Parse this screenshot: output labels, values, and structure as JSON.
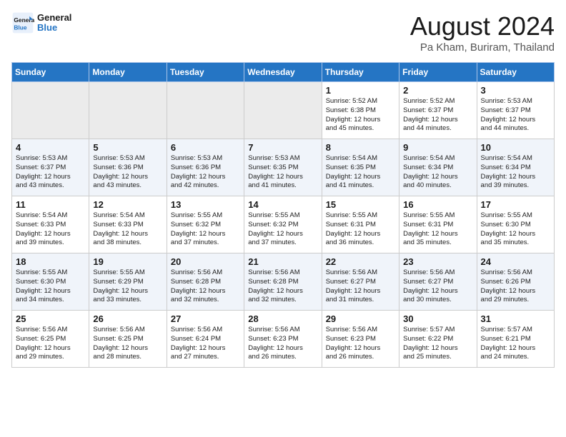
{
  "header": {
    "logo_line1": "General",
    "logo_line2": "Blue",
    "month": "August 2024",
    "location": "Pa Kham, Buriram, Thailand"
  },
  "days_of_week": [
    "Sunday",
    "Monday",
    "Tuesday",
    "Wednesday",
    "Thursday",
    "Friday",
    "Saturday"
  ],
  "weeks": [
    [
      {
        "day": "",
        "info": ""
      },
      {
        "day": "",
        "info": ""
      },
      {
        "day": "",
        "info": ""
      },
      {
        "day": "",
        "info": ""
      },
      {
        "day": "1",
        "info": "Sunrise: 5:52 AM\nSunset: 6:38 PM\nDaylight: 12 hours\nand 45 minutes."
      },
      {
        "day": "2",
        "info": "Sunrise: 5:52 AM\nSunset: 6:37 PM\nDaylight: 12 hours\nand 44 minutes."
      },
      {
        "day": "3",
        "info": "Sunrise: 5:53 AM\nSunset: 6:37 PM\nDaylight: 12 hours\nand 44 minutes."
      }
    ],
    [
      {
        "day": "4",
        "info": "Sunrise: 5:53 AM\nSunset: 6:37 PM\nDaylight: 12 hours\nand 43 minutes."
      },
      {
        "day": "5",
        "info": "Sunrise: 5:53 AM\nSunset: 6:36 PM\nDaylight: 12 hours\nand 43 minutes."
      },
      {
        "day": "6",
        "info": "Sunrise: 5:53 AM\nSunset: 6:36 PM\nDaylight: 12 hours\nand 42 minutes."
      },
      {
        "day": "7",
        "info": "Sunrise: 5:53 AM\nSunset: 6:35 PM\nDaylight: 12 hours\nand 41 minutes."
      },
      {
        "day": "8",
        "info": "Sunrise: 5:54 AM\nSunset: 6:35 PM\nDaylight: 12 hours\nand 41 minutes."
      },
      {
        "day": "9",
        "info": "Sunrise: 5:54 AM\nSunset: 6:34 PM\nDaylight: 12 hours\nand 40 minutes."
      },
      {
        "day": "10",
        "info": "Sunrise: 5:54 AM\nSunset: 6:34 PM\nDaylight: 12 hours\nand 39 minutes."
      }
    ],
    [
      {
        "day": "11",
        "info": "Sunrise: 5:54 AM\nSunset: 6:33 PM\nDaylight: 12 hours\nand 39 minutes."
      },
      {
        "day": "12",
        "info": "Sunrise: 5:54 AM\nSunset: 6:33 PM\nDaylight: 12 hours\nand 38 minutes."
      },
      {
        "day": "13",
        "info": "Sunrise: 5:55 AM\nSunset: 6:32 PM\nDaylight: 12 hours\nand 37 minutes."
      },
      {
        "day": "14",
        "info": "Sunrise: 5:55 AM\nSunset: 6:32 PM\nDaylight: 12 hours\nand 37 minutes."
      },
      {
        "day": "15",
        "info": "Sunrise: 5:55 AM\nSunset: 6:31 PM\nDaylight: 12 hours\nand 36 minutes."
      },
      {
        "day": "16",
        "info": "Sunrise: 5:55 AM\nSunset: 6:31 PM\nDaylight: 12 hours\nand 35 minutes."
      },
      {
        "day": "17",
        "info": "Sunrise: 5:55 AM\nSunset: 6:30 PM\nDaylight: 12 hours\nand 35 minutes."
      }
    ],
    [
      {
        "day": "18",
        "info": "Sunrise: 5:55 AM\nSunset: 6:30 PM\nDaylight: 12 hours\nand 34 minutes."
      },
      {
        "day": "19",
        "info": "Sunrise: 5:55 AM\nSunset: 6:29 PM\nDaylight: 12 hours\nand 33 minutes."
      },
      {
        "day": "20",
        "info": "Sunrise: 5:56 AM\nSunset: 6:28 PM\nDaylight: 12 hours\nand 32 minutes."
      },
      {
        "day": "21",
        "info": "Sunrise: 5:56 AM\nSunset: 6:28 PM\nDaylight: 12 hours\nand 32 minutes."
      },
      {
        "day": "22",
        "info": "Sunrise: 5:56 AM\nSunset: 6:27 PM\nDaylight: 12 hours\nand 31 minutes."
      },
      {
        "day": "23",
        "info": "Sunrise: 5:56 AM\nSunset: 6:27 PM\nDaylight: 12 hours\nand 30 minutes."
      },
      {
        "day": "24",
        "info": "Sunrise: 5:56 AM\nSunset: 6:26 PM\nDaylight: 12 hours\nand 29 minutes."
      }
    ],
    [
      {
        "day": "25",
        "info": "Sunrise: 5:56 AM\nSunset: 6:25 PM\nDaylight: 12 hours\nand 29 minutes."
      },
      {
        "day": "26",
        "info": "Sunrise: 5:56 AM\nSunset: 6:25 PM\nDaylight: 12 hours\nand 28 minutes."
      },
      {
        "day": "27",
        "info": "Sunrise: 5:56 AM\nSunset: 6:24 PM\nDaylight: 12 hours\nand 27 minutes."
      },
      {
        "day": "28",
        "info": "Sunrise: 5:56 AM\nSunset: 6:23 PM\nDaylight: 12 hours\nand 26 minutes."
      },
      {
        "day": "29",
        "info": "Sunrise: 5:56 AM\nSunset: 6:23 PM\nDaylight: 12 hours\nand 26 minutes."
      },
      {
        "day": "30",
        "info": "Sunrise: 5:57 AM\nSunset: 6:22 PM\nDaylight: 12 hours\nand 25 minutes."
      },
      {
        "day": "31",
        "info": "Sunrise: 5:57 AM\nSunset: 6:21 PM\nDaylight: 12 hours\nand 24 minutes."
      }
    ]
  ]
}
